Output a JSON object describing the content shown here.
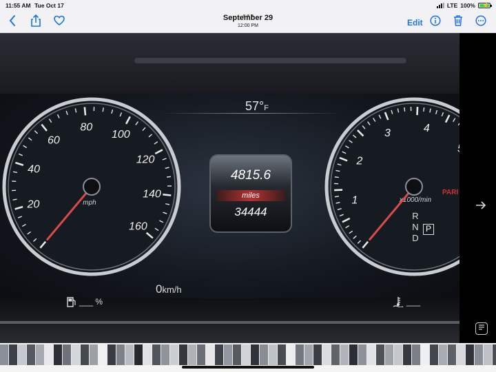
{
  "status_bar": {
    "time": "11:55 AM",
    "date": "Tue Oct 17",
    "network": "LTE",
    "battery": "100%"
  },
  "nav": {
    "title": "September 29",
    "subtitle": "12:00 PM",
    "back_icon": "chevron-left-icon",
    "share_icon": "share-icon",
    "favorite_icon": "heart-icon",
    "edit_label": "Edit",
    "info_icon": "info-icon",
    "trash_icon": "trash-icon",
    "more_icon": "ellipsis-icon"
  },
  "photo": {
    "temperature": "57°",
    "temperature_unit": "F",
    "speedometer": {
      "unit": "mph",
      "labels": [
        "20",
        "40",
        "60",
        "80",
        "100",
        "120",
        "140",
        "160"
      ]
    },
    "odometer": "4815.6",
    "odometer_unit": "miles",
    "trip": "34444",
    "speed_kmh_value": "0",
    "speed_kmh_unit": "km/h",
    "tachometer": {
      "unit": "x1000/min",
      "labels": [
        "1",
        "2",
        "3",
        "4",
        "5"
      ]
    },
    "gear_letters": [
      "R",
      "N",
      "D"
    ],
    "gear_selected": "P",
    "park_text": "PARI",
    "fuel_reading": "___ %",
    "coolant_reading": "___"
  },
  "colors": {
    "accent": "#1a73e8",
    "needle": "#d94b4b",
    "battery": "#3ec93e"
  },
  "side": {
    "next_icon": "arrow-right-icon",
    "live_text_icon": "live-text-icon"
  },
  "strip": {
    "thumbnail_colors": [
      "#8a8f99",
      "#3b3f47",
      "#c6c9cf",
      "#555a62",
      "#a5a9b0",
      "#e8e8ea",
      "#2c2f35",
      "#6e737b",
      "#d3d6da",
      "#44484f",
      "#9ca0a7",
      "#f0f0f1",
      "#383b41",
      "#7d828a",
      "#b8bbc1",
      "#262930",
      "#dfe1e4",
      "#50545b",
      "#8f949b",
      "#c9ccd1",
      "#34373d",
      "#aeb2b8",
      "#6a6e75",
      "#e6e7e9",
      "#3f434a",
      "#9296a0",
      "#565a61",
      "#cfd2d6",
      "#2f3238",
      "#878b93",
      "#bfc2c7",
      "#484c53",
      "#eceded",
      "#737780",
      "#a1a5ac",
      "#3a3d43",
      "#d9dbde",
      "#5f636a",
      "#b0b4ba",
      "#2a2d33",
      "#8c9098",
      "#e0e2e5",
      "#4d5158",
      "#9ea2a9",
      "#c3c6cb",
      "#36393f",
      "#7a7e86",
      "#eff0f1",
      "#42464d",
      "#a8acb2",
      "#5c6067",
      "#d6d8db",
      "#31343a",
      "#898d95",
      "#bdc0c5",
      "#4a4e55"
    ]
  }
}
